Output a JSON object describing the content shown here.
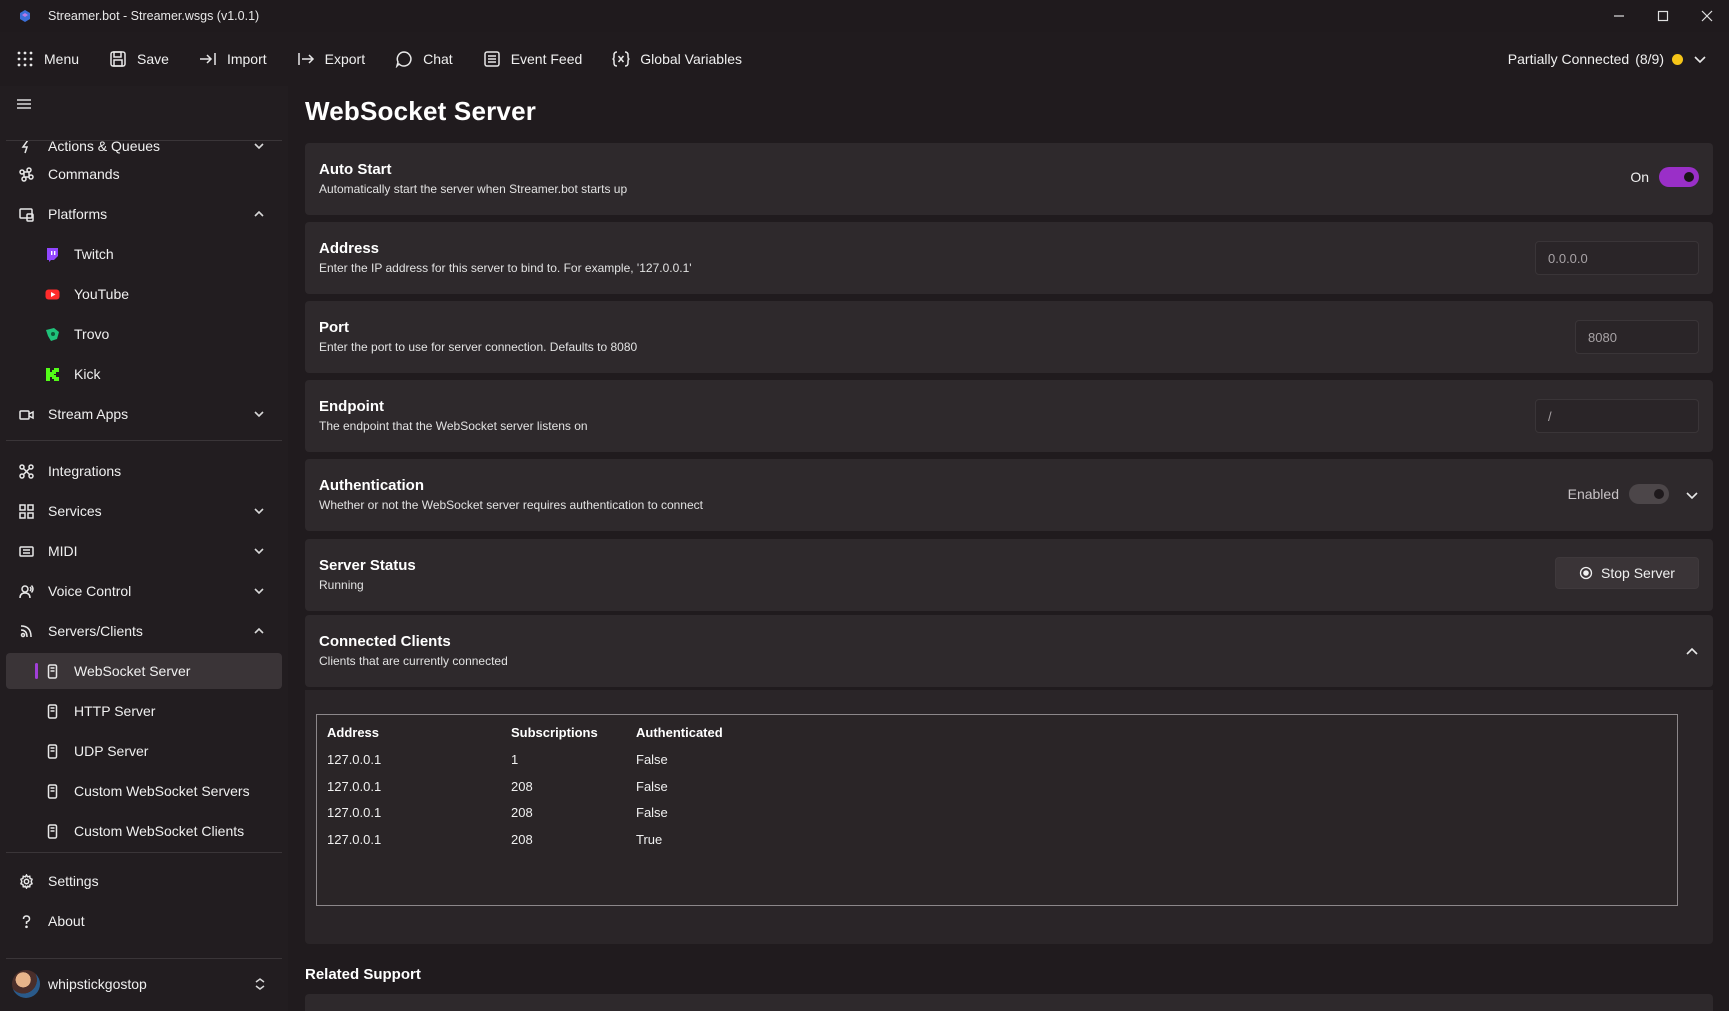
{
  "window": {
    "title": "Streamer.bot - Streamer.wsgs (v1.0.1)"
  },
  "toolbar": {
    "menu": "Menu",
    "save": "Save",
    "import": "Import",
    "export": "Export",
    "chat": "Chat",
    "event_feed": "Event Feed",
    "global_variables": "Global Variables"
  },
  "connection": {
    "label": "Partially Connected",
    "count": "(8/9)",
    "status_color": "#f5c518"
  },
  "sidebar": {
    "items": {
      "actions": "Actions & Queues",
      "commands": "Commands",
      "platforms": "Platforms",
      "twitch": "Twitch",
      "youtube": "YouTube",
      "trovo": "Trovo",
      "kick": "Kick",
      "stream_apps": "Stream Apps",
      "integrations": "Integrations",
      "services": "Services",
      "midi": "MIDI",
      "voice_control": "Voice Control",
      "servers_clients": "Servers/Clients",
      "websocket_server": "WebSocket Server",
      "http_server": "HTTP Server",
      "udp_server": "UDP Server",
      "custom_ws_servers": "Custom WebSocket Servers",
      "custom_ws_clients": "Custom WebSocket Clients",
      "settings": "Settings",
      "about": "About"
    },
    "user": {
      "name": "whipstickgostop"
    }
  },
  "page": {
    "title": "WebSocket Server",
    "auto_start": {
      "title": "Auto Start",
      "desc": "Automatically start the server when Streamer.bot starts up",
      "state_label": "On"
    },
    "address": {
      "title": "Address",
      "desc": "Enter the IP address for this server to bind to. For example, '127.0.0.1'",
      "value": "0.0.0.0"
    },
    "port": {
      "title": "Port",
      "desc": "Enter the port to use for server connection. Defaults to 8080",
      "value": "8080"
    },
    "endpoint": {
      "title": "Endpoint",
      "desc": "The endpoint that the WebSocket server listens on",
      "value": "/"
    },
    "authentication": {
      "title": "Authentication",
      "desc": "Whether or not the WebSocket server requires authentication to connect",
      "state_label": "Enabled"
    },
    "server_status": {
      "title": "Server Status",
      "desc": "Running",
      "button": "Stop Server"
    },
    "connected_clients": {
      "title": "Connected Clients",
      "desc": "Clients that are currently connected",
      "columns": [
        "Address",
        "Subscriptions",
        "Authenticated"
      ],
      "rows": [
        [
          "127.0.0.1",
          "1",
          "False"
        ],
        [
          "127.0.0.1",
          "208",
          "False"
        ],
        [
          "127.0.0.1",
          "208",
          "False"
        ],
        [
          "127.0.0.1",
          "208",
          "True"
        ]
      ]
    },
    "related_support": "Related Support"
  }
}
